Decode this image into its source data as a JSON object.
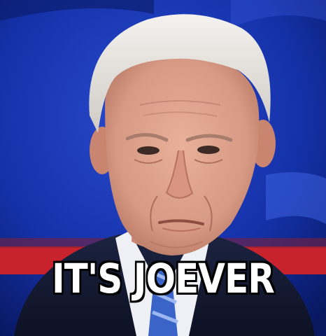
{
  "meme": {
    "caption": "IT'S JOEVER"
  },
  "colors": {
    "background_blue": "#0b1e6e",
    "stage_red": "#c8232c",
    "caption_fill": "#ffffff",
    "caption_outline": "#000000"
  },
  "icons": [
    "portrait-photo"
  ]
}
